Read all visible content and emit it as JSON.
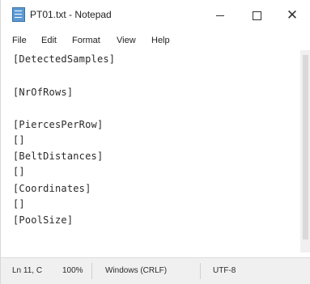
{
  "window": {
    "title": "PT01.txt - Notepad",
    "minimize_label": "—",
    "maximize_label": "☐",
    "close_label": "✕"
  },
  "menu": {
    "items": [
      "File",
      "Edit",
      "Format",
      "View",
      "Help"
    ]
  },
  "editor": {
    "lines": [
      "[DetectedSamples]",
      "",
      "[NrOfRows]",
      "",
      "[PiercesPerRow]",
      "[]",
      "[BeltDistances]",
      "[]",
      "[Coordinates]",
      "[]",
      "[PoolSize]"
    ]
  },
  "status": {
    "position": "Ln 11, C",
    "zoom": "100%",
    "line_ending": "Windows (CRLF)",
    "encoding": "UTF-8"
  },
  "icons": {
    "app": "notepad-icon",
    "minimize": "minimize-icon",
    "maximize": "maximize-icon",
    "close": "close-icon"
  }
}
